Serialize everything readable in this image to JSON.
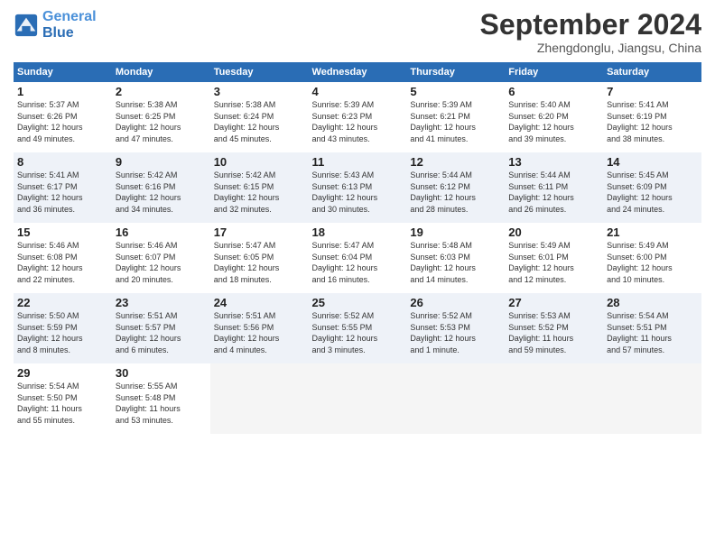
{
  "header": {
    "logo_line1": "General",
    "logo_line2": "Blue",
    "month": "September 2024",
    "location": "Zhengdonglu, Jiangsu, China"
  },
  "weekdays": [
    "Sunday",
    "Monday",
    "Tuesday",
    "Wednesday",
    "Thursday",
    "Friday",
    "Saturday"
  ],
  "weeks": [
    [
      {
        "day": "1",
        "info": "Sunrise: 5:37 AM\nSunset: 6:26 PM\nDaylight: 12 hours\nand 49 minutes."
      },
      {
        "day": "2",
        "info": "Sunrise: 5:38 AM\nSunset: 6:25 PM\nDaylight: 12 hours\nand 47 minutes."
      },
      {
        "day": "3",
        "info": "Sunrise: 5:38 AM\nSunset: 6:24 PM\nDaylight: 12 hours\nand 45 minutes."
      },
      {
        "day": "4",
        "info": "Sunrise: 5:39 AM\nSunset: 6:23 PM\nDaylight: 12 hours\nand 43 minutes."
      },
      {
        "day": "5",
        "info": "Sunrise: 5:39 AM\nSunset: 6:21 PM\nDaylight: 12 hours\nand 41 minutes."
      },
      {
        "day": "6",
        "info": "Sunrise: 5:40 AM\nSunset: 6:20 PM\nDaylight: 12 hours\nand 39 minutes."
      },
      {
        "day": "7",
        "info": "Sunrise: 5:41 AM\nSunset: 6:19 PM\nDaylight: 12 hours\nand 38 minutes."
      }
    ],
    [
      {
        "day": "8",
        "info": "Sunrise: 5:41 AM\nSunset: 6:17 PM\nDaylight: 12 hours\nand 36 minutes."
      },
      {
        "day": "9",
        "info": "Sunrise: 5:42 AM\nSunset: 6:16 PM\nDaylight: 12 hours\nand 34 minutes."
      },
      {
        "day": "10",
        "info": "Sunrise: 5:42 AM\nSunset: 6:15 PM\nDaylight: 12 hours\nand 32 minutes."
      },
      {
        "day": "11",
        "info": "Sunrise: 5:43 AM\nSunset: 6:13 PM\nDaylight: 12 hours\nand 30 minutes."
      },
      {
        "day": "12",
        "info": "Sunrise: 5:44 AM\nSunset: 6:12 PM\nDaylight: 12 hours\nand 28 minutes."
      },
      {
        "day": "13",
        "info": "Sunrise: 5:44 AM\nSunset: 6:11 PM\nDaylight: 12 hours\nand 26 minutes."
      },
      {
        "day": "14",
        "info": "Sunrise: 5:45 AM\nSunset: 6:09 PM\nDaylight: 12 hours\nand 24 minutes."
      }
    ],
    [
      {
        "day": "15",
        "info": "Sunrise: 5:46 AM\nSunset: 6:08 PM\nDaylight: 12 hours\nand 22 minutes."
      },
      {
        "day": "16",
        "info": "Sunrise: 5:46 AM\nSunset: 6:07 PM\nDaylight: 12 hours\nand 20 minutes."
      },
      {
        "day": "17",
        "info": "Sunrise: 5:47 AM\nSunset: 6:05 PM\nDaylight: 12 hours\nand 18 minutes."
      },
      {
        "day": "18",
        "info": "Sunrise: 5:47 AM\nSunset: 6:04 PM\nDaylight: 12 hours\nand 16 minutes."
      },
      {
        "day": "19",
        "info": "Sunrise: 5:48 AM\nSunset: 6:03 PM\nDaylight: 12 hours\nand 14 minutes."
      },
      {
        "day": "20",
        "info": "Sunrise: 5:49 AM\nSunset: 6:01 PM\nDaylight: 12 hours\nand 12 minutes."
      },
      {
        "day": "21",
        "info": "Sunrise: 5:49 AM\nSunset: 6:00 PM\nDaylight: 12 hours\nand 10 minutes."
      }
    ],
    [
      {
        "day": "22",
        "info": "Sunrise: 5:50 AM\nSunset: 5:59 PM\nDaylight: 12 hours\nand 8 minutes."
      },
      {
        "day": "23",
        "info": "Sunrise: 5:51 AM\nSunset: 5:57 PM\nDaylight: 12 hours\nand 6 minutes."
      },
      {
        "day": "24",
        "info": "Sunrise: 5:51 AM\nSunset: 5:56 PM\nDaylight: 12 hours\nand 4 minutes."
      },
      {
        "day": "25",
        "info": "Sunrise: 5:52 AM\nSunset: 5:55 PM\nDaylight: 12 hours\nand 3 minutes."
      },
      {
        "day": "26",
        "info": "Sunrise: 5:52 AM\nSunset: 5:53 PM\nDaylight: 12 hours\nand 1 minute."
      },
      {
        "day": "27",
        "info": "Sunrise: 5:53 AM\nSunset: 5:52 PM\nDaylight: 11 hours\nand 59 minutes."
      },
      {
        "day": "28",
        "info": "Sunrise: 5:54 AM\nSunset: 5:51 PM\nDaylight: 11 hours\nand 57 minutes."
      }
    ],
    [
      {
        "day": "29",
        "info": "Sunrise: 5:54 AM\nSunset: 5:50 PM\nDaylight: 11 hours\nand 55 minutes."
      },
      {
        "day": "30",
        "info": "Sunrise: 5:55 AM\nSunset: 5:48 PM\nDaylight: 11 hours\nand 53 minutes."
      },
      null,
      null,
      null,
      null,
      null
    ]
  ]
}
